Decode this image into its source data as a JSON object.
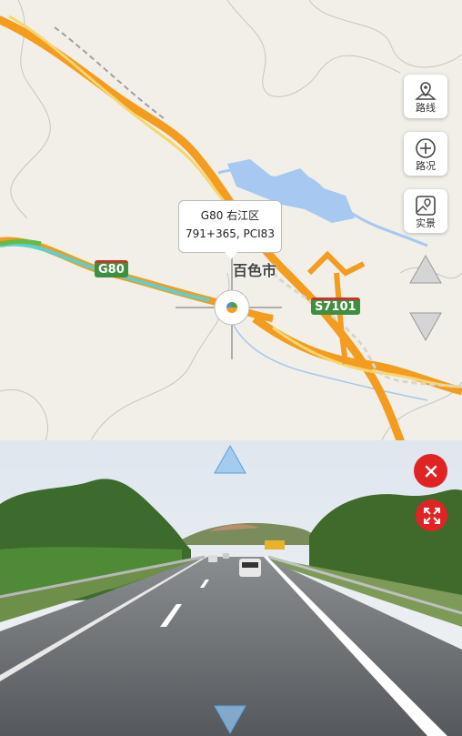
{
  "map": {
    "city_label": "百色市",
    "route_shields": [
      {
        "code": "G80"
      },
      {
        "code": "S7101"
      }
    ],
    "tooltip": {
      "line1": "G80 右江区",
      "line2": "791+365, PCI83"
    },
    "side_buttons": [
      {
        "id": "route",
        "label": "路线",
        "icon": "map-pin-icon"
      },
      {
        "id": "traffic",
        "label": "路况",
        "icon": "plus-circle-icon"
      },
      {
        "id": "live",
        "label": "实景",
        "icon": "photo-map-icon"
      }
    ]
  },
  "colors": {
    "map_bg": "#f1efe8",
    "highway": "#f39c1e",
    "highway_yellow": "#f5d76e",
    "water": "#a7c8f0",
    "accent_red": "#e02424"
  }
}
